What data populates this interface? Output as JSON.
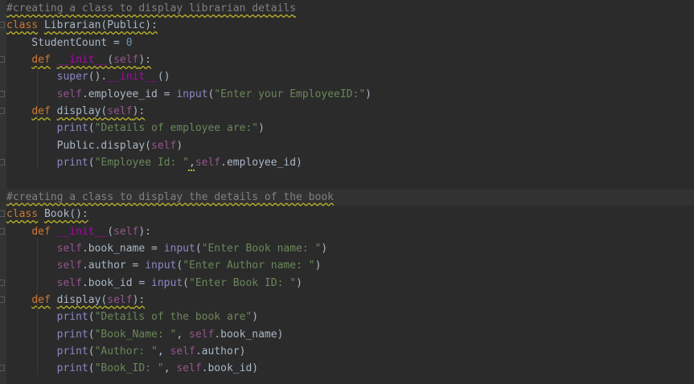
{
  "editor": {
    "language": "Python",
    "colors": {
      "background": "#2b2b2b",
      "keyword": "#cc7832",
      "comment": "#808080",
      "string": "#6a8759",
      "number": "#6897bb",
      "self": "#94558d",
      "builtin": "#8888c6",
      "dunder": "#b200b2",
      "default": "#a9b7c6"
    },
    "lines": [
      {
        "tokens": [
          {
            "t": "#creating a class to display librarian details",
            "c": "cm wavy"
          }
        ]
      },
      {
        "tokens": [
          {
            "t": "class",
            "c": "kw wavy"
          },
          {
            "t": " ",
            "c": "df"
          },
          {
            "t": "Librarian(Public):",
            "c": "df wavy"
          }
        ]
      },
      {
        "tokens": [
          {
            "t": "    StudentCount = ",
            "c": "df"
          },
          {
            "t": "0",
            "c": "nm"
          }
        ]
      },
      {
        "tokens": [
          {
            "t": "    ",
            "c": "df"
          },
          {
            "t": "def",
            "c": "kw wavy"
          },
          {
            "t": " ",
            "c": "df"
          },
          {
            "t": "__init__",
            "c": "dn wavy"
          },
          {
            "t": "(",
            "c": "df wavy"
          },
          {
            "t": "self",
            "c": "sf wavy"
          },
          {
            "t": "):",
            "c": "df wavy"
          }
        ]
      },
      {
        "tokens": [
          {
            "t": "        ",
            "c": "df"
          },
          {
            "t": "super",
            "c": "bi"
          },
          {
            "t": "().",
            "c": "df"
          },
          {
            "t": "__init__",
            "c": "dn"
          },
          {
            "t": "()",
            "c": "df"
          }
        ]
      },
      {
        "tokens": [
          {
            "t": "        ",
            "c": "df"
          },
          {
            "t": "self",
            "c": "sf"
          },
          {
            "t": ".employee_id = ",
            "c": "df"
          },
          {
            "t": "input",
            "c": "bi"
          },
          {
            "t": "(",
            "c": "df"
          },
          {
            "t": "\"Enter your EmployeeID:\"",
            "c": "st"
          },
          {
            "t": ")",
            "c": "df"
          }
        ]
      },
      {
        "tokens": [
          {
            "t": "    ",
            "c": "df"
          },
          {
            "t": "def",
            "c": "kw wavy"
          },
          {
            "t": " ",
            "c": "df"
          },
          {
            "t": "display",
            "c": "df wavy"
          },
          {
            "t": "(",
            "c": "df wavy"
          },
          {
            "t": "self",
            "c": "sf wavy"
          },
          {
            "t": "):",
            "c": "df wavy"
          }
        ]
      },
      {
        "tokens": [
          {
            "t": "        ",
            "c": "df"
          },
          {
            "t": "print",
            "c": "bi"
          },
          {
            "t": "(",
            "c": "df"
          },
          {
            "t": "\"Details of employee are:\"",
            "c": "st"
          },
          {
            "t": ")",
            "c": "df"
          }
        ]
      },
      {
        "tokens": [
          {
            "t": "        Public.display(",
            "c": "df"
          },
          {
            "t": "self",
            "c": "sf"
          },
          {
            "t": ")",
            "c": "df"
          }
        ]
      },
      {
        "tokens": [
          {
            "t": "        ",
            "c": "df"
          },
          {
            "t": "print",
            "c": "bi"
          },
          {
            "t": "(",
            "c": "df"
          },
          {
            "t": "\"Employee Id: \"",
            "c": "st"
          },
          {
            "t": ",",
            "c": "comma-mark"
          },
          {
            "t": "self",
            "c": "sf"
          },
          {
            "t": ".employee_id)",
            "c": "df"
          }
        ]
      },
      {
        "tokens": [
          {
            "t": "",
            "c": "df"
          }
        ]
      },
      {
        "tokens": [
          {
            "t": "#creating a class to display the details of the book",
            "c": "cm wavy"
          }
        ],
        "current": true
      },
      {
        "tokens": [
          {
            "t": "class",
            "c": "kw wavy"
          },
          {
            "t": " ",
            "c": "df"
          },
          {
            "t": "Book():",
            "c": "df wavy"
          }
        ]
      },
      {
        "tokens": [
          {
            "t": "    ",
            "c": "df"
          },
          {
            "t": "def",
            "c": "kw"
          },
          {
            "t": " ",
            "c": "df"
          },
          {
            "t": "__init__",
            "c": "dn"
          },
          {
            "t": "(",
            "c": "df"
          },
          {
            "t": "self",
            "c": "sf"
          },
          {
            "t": "):",
            "c": "df"
          }
        ]
      },
      {
        "tokens": [
          {
            "t": "        ",
            "c": "df"
          },
          {
            "t": "self",
            "c": "sf"
          },
          {
            "t": ".book_name = ",
            "c": "df"
          },
          {
            "t": "input",
            "c": "bi"
          },
          {
            "t": "(",
            "c": "df"
          },
          {
            "t": "\"Enter Book name: \"",
            "c": "st"
          },
          {
            "t": ")",
            "c": "df"
          }
        ]
      },
      {
        "tokens": [
          {
            "t": "        ",
            "c": "df"
          },
          {
            "t": "self",
            "c": "sf"
          },
          {
            "t": ".author = ",
            "c": "df"
          },
          {
            "t": "input",
            "c": "bi"
          },
          {
            "t": "(",
            "c": "df"
          },
          {
            "t": "\"Enter Author name: \"",
            "c": "st"
          },
          {
            "t": ")",
            "c": "df"
          }
        ]
      },
      {
        "tokens": [
          {
            "t": "        ",
            "c": "df"
          },
          {
            "t": "self",
            "c": "sf"
          },
          {
            "t": ".book_id = ",
            "c": "df"
          },
          {
            "t": "input",
            "c": "bi"
          },
          {
            "t": "(",
            "c": "df"
          },
          {
            "t": "\"Enter Book ID: \"",
            "c": "st"
          },
          {
            "t": ")",
            "c": "df"
          }
        ]
      },
      {
        "tokens": [
          {
            "t": "    ",
            "c": "df"
          },
          {
            "t": "def",
            "c": "kw wavy"
          },
          {
            "t": " ",
            "c": "df"
          },
          {
            "t": "display",
            "c": "df wavy"
          },
          {
            "t": "(",
            "c": "df wavy"
          },
          {
            "t": "self",
            "c": "sf wavy"
          },
          {
            "t": "):",
            "c": "df wavy"
          }
        ]
      },
      {
        "tokens": [
          {
            "t": "        ",
            "c": "df"
          },
          {
            "t": "print",
            "c": "bi"
          },
          {
            "t": "(",
            "c": "df"
          },
          {
            "t": "\"Details of the book are\"",
            "c": "st"
          },
          {
            "t": ")",
            "c": "df"
          }
        ]
      },
      {
        "tokens": [
          {
            "t": "        ",
            "c": "df"
          },
          {
            "t": "print",
            "c": "bi"
          },
          {
            "t": "(",
            "c": "df"
          },
          {
            "t": "\"Book_Name: \"",
            "c": "st"
          },
          {
            "t": ", ",
            "c": "df"
          },
          {
            "t": "self",
            "c": "sf"
          },
          {
            "t": ".book_name)",
            "c": "df"
          }
        ]
      },
      {
        "tokens": [
          {
            "t": "        ",
            "c": "df"
          },
          {
            "t": "print",
            "c": "bi"
          },
          {
            "t": "(",
            "c": "df"
          },
          {
            "t": "\"Author: \"",
            "c": "st"
          },
          {
            "t": ", ",
            "c": "df"
          },
          {
            "t": "self",
            "c": "sf"
          },
          {
            "t": ".author)",
            "c": "df"
          }
        ]
      },
      {
        "tokens": [
          {
            "t": "        ",
            "c": "df"
          },
          {
            "t": "print",
            "c": "bi"
          },
          {
            "t": "(",
            "c": "df"
          },
          {
            "t": "\"Book_ID: \"",
            "c": "st"
          },
          {
            "t": ", ",
            "c": "df"
          },
          {
            "t": "self",
            "c": "sf"
          },
          {
            "t": ".book_id)",
            "c": "df"
          }
        ]
      }
    ]
  }
}
